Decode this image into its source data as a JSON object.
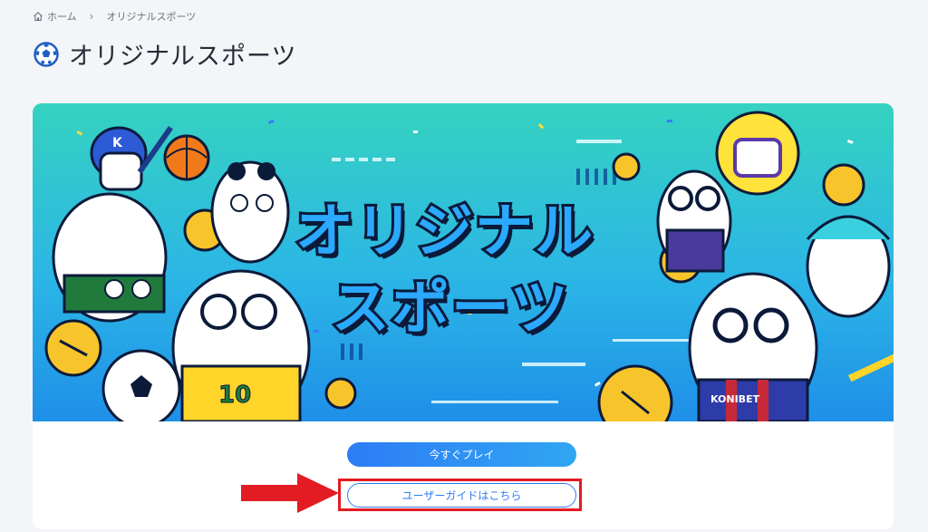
{
  "breadcrumb": {
    "home_label": "ホーム",
    "separator": "›",
    "current_label": "オリジナルスポーツ"
  },
  "page": {
    "title": "オリジナルスポーツ",
    "title_icon": "soccer-ball-icon"
  },
  "banner": {
    "title_line1": "オリジナル",
    "title_line2": "スポーツ",
    "jersey_text": "KONIBET",
    "jersey_number": "10",
    "helmet_letter": "K"
  },
  "actions": {
    "play_label": "今すぐプレイ",
    "guide_label": "ユーザーガイドはこちら"
  },
  "colors": {
    "accent": "#2e7cf6",
    "highlight": "#e31b23",
    "background": "#f4f5f8"
  }
}
